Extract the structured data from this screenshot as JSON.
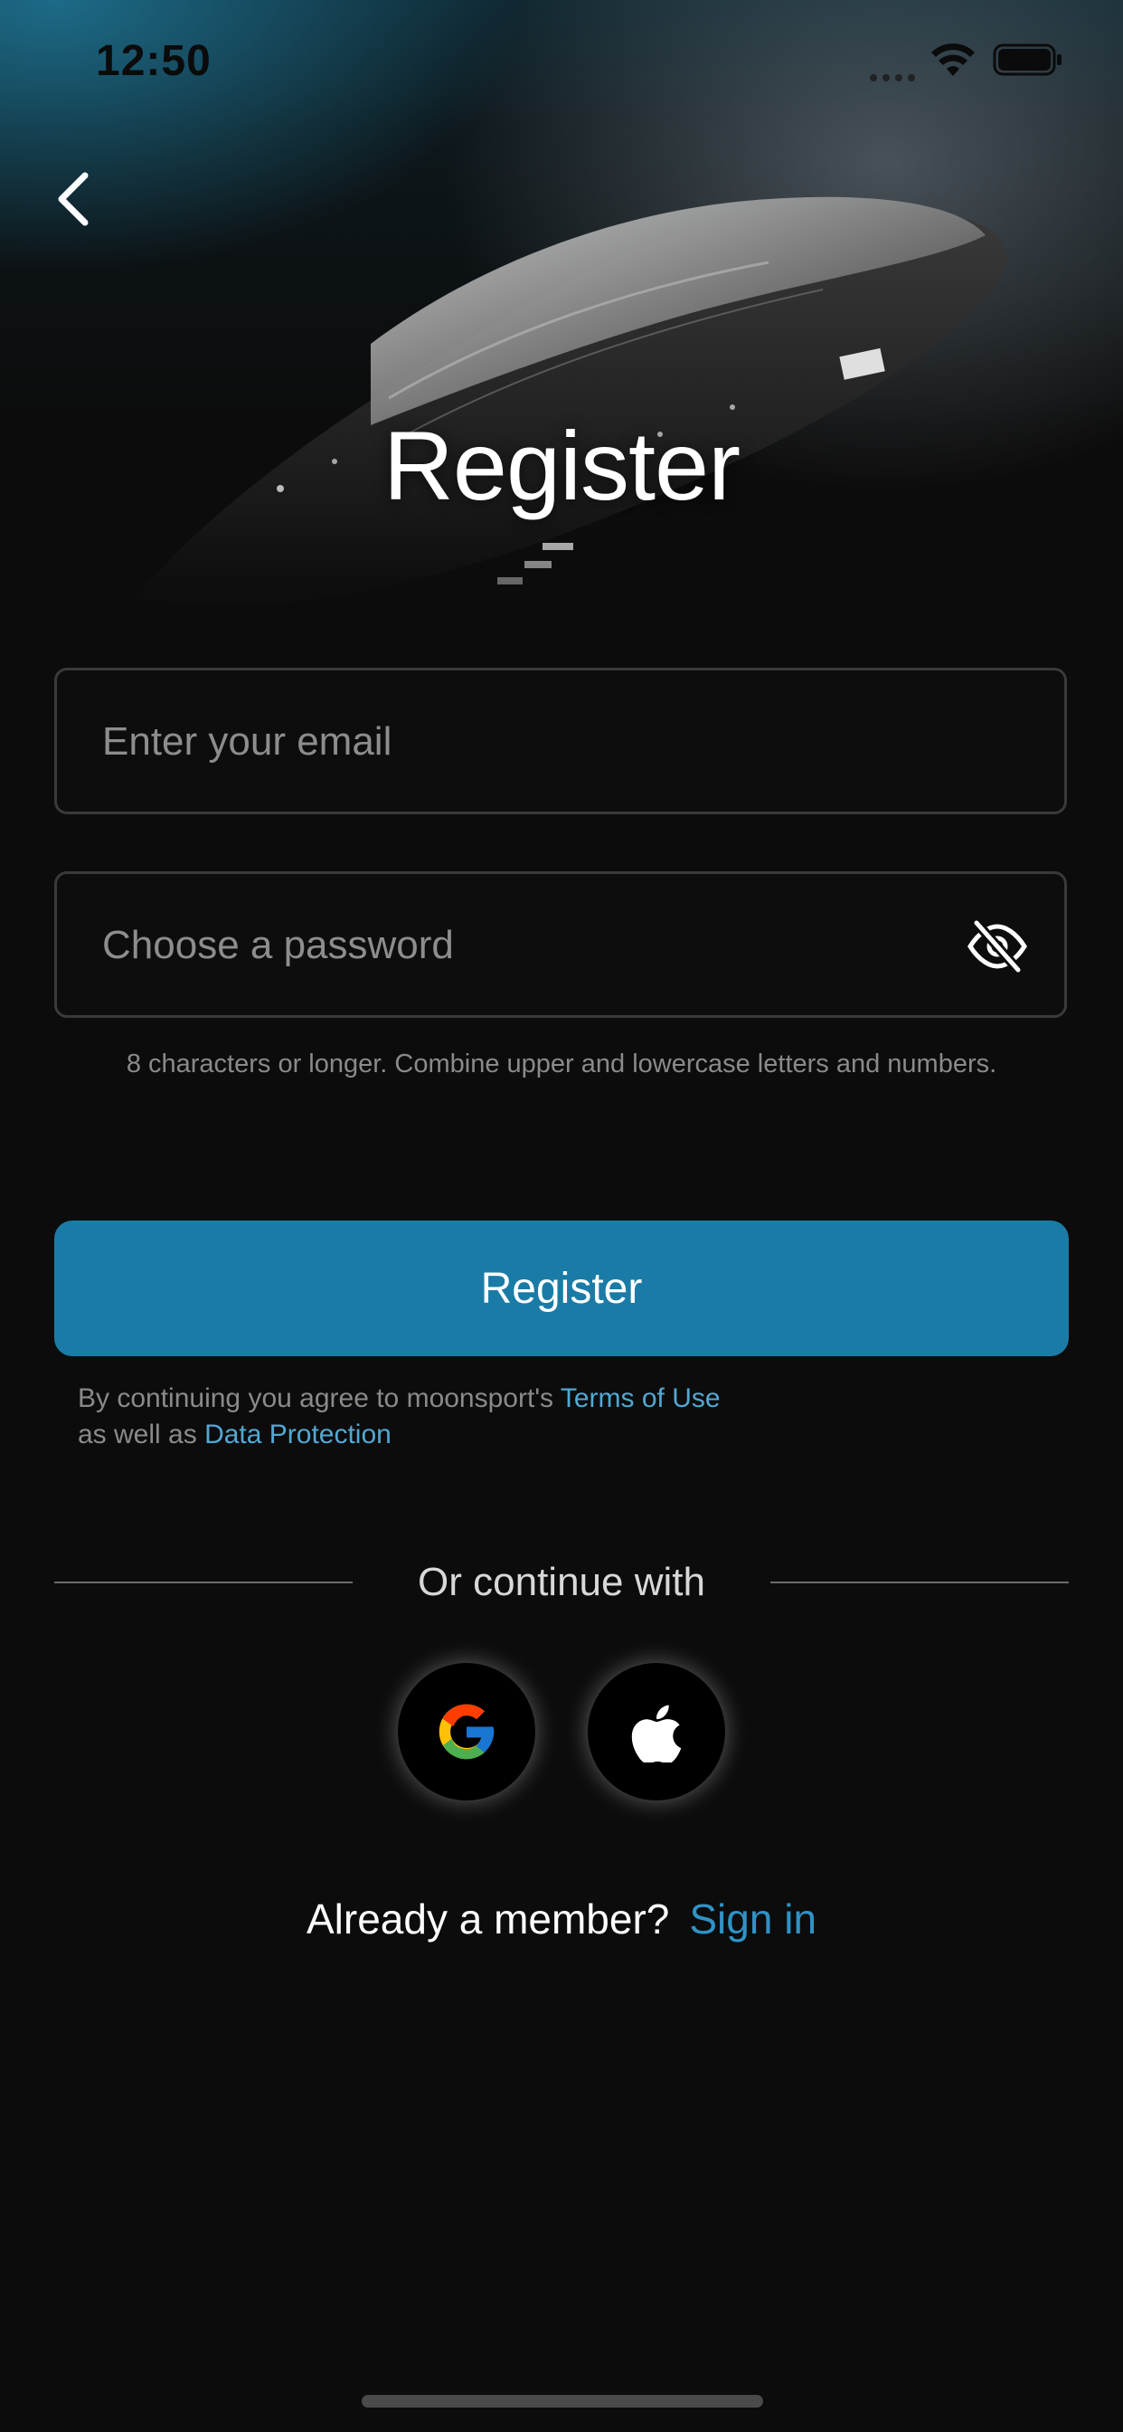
{
  "status_bar": {
    "time": "12:50"
  },
  "header": {
    "title": "Register"
  },
  "form": {
    "email": {
      "placeholder": "Enter your email",
      "value": ""
    },
    "password": {
      "placeholder": "Choose a password",
      "value": ""
    },
    "password_hint": "8 characters or longer. Combine upper and lowercase letters and numbers.",
    "submit_label": "Register"
  },
  "legal": {
    "prefix": "By continuing you agree to moonsport's",
    "terms_link": "Terms of Use",
    "middle": "as well as",
    "privacy_link": "Data Protection"
  },
  "social": {
    "divider_text": "Or continue with",
    "providers": [
      {
        "name": "Google",
        "icon": "google-icon"
      },
      {
        "name": "Apple",
        "icon": "apple-icon"
      }
    ]
  },
  "footer": {
    "prompt": "Already a member?",
    "signin_link": "Sign in"
  },
  "colors": {
    "background": "#0c0c0c",
    "accent": "#1a7ca6",
    "link": "#52a8d4",
    "signin_link": "#2f93c6",
    "field_border": "#3a3a3a"
  }
}
